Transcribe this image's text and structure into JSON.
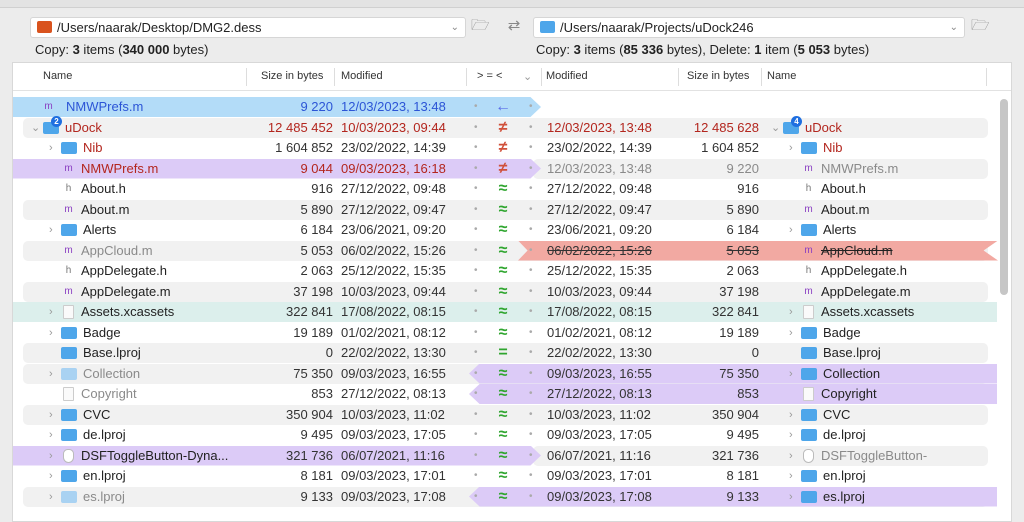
{
  "left_path": "/Users/naarak/Desktop/DMG2.dess",
  "right_path": "/Users/naarak/Projects/uDock246",
  "left_summary": {
    "a": "Copy: ",
    "b": "3",
    "c": " items (",
    "d": "340 000",
    "e": " bytes)"
  },
  "right_summary": {
    "a": "Copy: ",
    "b": "3",
    "c": " items (",
    "d": "85 336",
    "e": " bytes), Delete: ",
    "f": "1",
    "g": " item (",
    "h": "5 053",
    "i": " bytes)"
  },
  "columns": {
    "name": "Name",
    "size": "Size in bytes",
    "modified": "Modified",
    "compare": "> = <",
    "r_modified": "Modified",
    "r_size": "Size in bytes",
    "r_name": "Name"
  },
  "colors": {
    "accent": "#1f6fe0",
    "blue_band": "#b3dcf8",
    "purple_band": "#dccbf7",
    "red_band": "#f2a9a2",
    "teal_band": "#dcefec",
    "diff_red": "#b3261e",
    "same_green": "#2fa52f"
  },
  "rows": [
    {
      "style": "blue-left",
      "sign": "←",
      "l": {
        "name": "NMWPrefs.m",
        "size": "9 220",
        "date": "12/03/2023, 13:48",
        "icon": "m",
        "lvl": 0,
        "tc": "blue"
      },
      "r": null
    },
    {
      "style": "gray",
      "sign": "≠",
      "l": {
        "name": "uDock",
        "size": "12 485 452",
        "date": "10/03/2023, 09:44",
        "icon": "folder",
        "lvl": 0,
        "open": true,
        "badge": "2",
        "tc": "red",
        "nc": "red"
      },
      "r": {
        "name": "uDock",
        "size": "12 485 628",
        "date": "12/03/2023, 13:48",
        "icon": "folder",
        "lvl": 0,
        "open": true,
        "badge": "4",
        "tc": "red",
        "nc": "red"
      }
    },
    {
      "style": "",
      "sign": "≠",
      "l": {
        "name": "Nib",
        "size": "1 604 852",
        "date": "23/02/2022, 14:39",
        "icon": "folder",
        "lvl": 1,
        "chev": true,
        "nc": "red"
      },
      "r": {
        "name": "Nib",
        "size": "1 604 852",
        "date": "23/02/2022, 14:39",
        "icon": "folder",
        "lvl": 1,
        "chev": true,
        "nc": "red"
      }
    },
    {
      "style": "purple-left gray-right",
      "sign": "≠",
      "l": {
        "name": "NMWPrefs.m",
        "size": "9 044",
        "date": "09/03/2023, 16:18",
        "icon": "m",
        "lvl": 1,
        "tc": "red"
      },
      "r": {
        "name": "NMWPrefs.m",
        "size": "9 220",
        "date": "12/03/2023, 13:48",
        "icon": "m",
        "lvl": 1,
        "tc": "gray",
        "nc": "gray"
      }
    },
    {
      "style": "",
      "sign": "≈",
      "l": {
        "name": "About.h",
        "size": "916",
        "date": "27/12/2022, 09:48",
        "icon": "h",
        "lvl": 1
      },
      "r": {
        "name": "About.h",
        "size": "916",
        "date": "27/12/2022, 09:48",
        "icon": "h",
        "lvl": 1
      }
    },
    {
      "style": "gray",
      "sign": "≈",
      "l": {
        "name": "About.m",
        "size": "5 890",
        "date": "27/12/2022, 09:47",
        "icon": "m",
        "lvl": 1
      },
      "r": {
        "name": "About.m",
        "size": "5 890",
        "date": "27/12/2022, 09:47",
        "icon": "m",
        "lvl": 1
      }
    },
    {
      "style": "",
      "sign": "≈",
      "l": {
        "name": "Alerts",
        "size": "6 184",
        "date": "23/06/2021, 09:20",
        "icon": "folder",
        "lvl": 1,
        "chev": true
      },
      "r": {
        "name": "Alerts",
        "size": "6 184",
        "date": "23/06/2021, 09:20",
        "icon": "folder",
        "lvl": 1,
        "chev": true
      }
    },
    {
      "style": "gray red-right",
      "sign": "≈",
      "l": {
        "name": "AppCloud.m",
        "size": "5 053",
        "date": "06/02/2022, 15:26",
        "icon": "m",
        "lvl": 1,
        "nc": "gray"
      },
      "r": {
        "name": "AppCloud.m",
        "size": "5 053",
        "date": "06/02/2022, 15:26",
        "icon": "m",
        "lvl": 1,
        "strike": true
      }
    },
    {
      "style": "",
      "sign": "≈",
      "l": {
        "name": "AppDelegate.h",
        "size": "2 063",
        "date": "25/12/2022, 15:35",
        "icon": "h",
        "lvl": 1
      },
      "r": {
        "name": "AppDelegate.h",
        "size": "2 063",
        "date": "25/12/2022, 15:35",
        "icon": "h",
        "lvl": 1
      }
    },
    {
      "style": "gray",
      "sign": "≈",
      "l": {
        "name": "AppDelegate.m",
        "size": "37 198",
        "date": "10/03/2023, 09:44",
        "icon": "m",
        "lvl": 1
      },
      "r": {
        "name": "AppDelegate.m",
        "size": "37 198",
        "date": "10/03/2023, 09:44",
        "icon": "m",
        "lvl": 1
      }
    },
    {
      "style": "teal",
      "sign": "≈",
      "l": {
        "name": "Assets.xcassets",
        "size": "322 841",
        "date": "17/08/2022, 08:15",
        "icon": "blank",
        "lvl": 1,
        "chev": true
      },
      "r": {
        "name": "Assets.xcassets",
        "size": "322 841",
        "date": "17/08/2022, 08:15",
        "icon": "blank",
        "lvl": 1,
        "chev": true
      }
    },
    {
      "style": "",
      "sign": "≈",
      "l": {
        "name": "Badge",
        "size": "19 189",
        "date": "01/02/2021, 08:12",
        "icon": "folder",
        "lvl": 1,
        "chev": true
      },
      "r": {
        "name": "Badge",
        "size": "19 189",
        "date": "01/02/2021, 08:12",
        "icon": "folder",
        "lvl": 1,
        "chev": true
      }
    },
    {
      "style": "gray",
      "sign": "=",
      "l": {
        "name": "Base.lproj",
        "size": "0",
        "date": "22/02/2022, 13:30",
        "icon": "folder",
        "lvl": 1
      },
      "r": {
        "name": "Base.lproj",
        "size": "0",
        "date": "22/02/2022, 13:30",
        "icon": "folder",
        "lvl": 1
      }
    },
    {
      "style": "gray purple-right",
      "sign": "≈",
      "l": {
        "name": "Collection",
        "size": "75 350",
        "date": "09/03/2023, 16:55",
        "icon": "folder",
        "pale": true,
        "lvl": 1,
        "chev": true,
        "nc": "gray"
      },
      "r": {
        "name": "Collection",
        "size": "75 350",
        "date": "09/03/2023, 16:55",
        "icon": "folder",
        "lvl": 1,
        "chev": true
      }
    },
    {
      "style": "purple-right",
      "sign": "≈",
      "l": {
        "name": "Copyright",
        "size": "853",
        "date": "27/12/2022, 08:13",
        "icon": "blank",
        "lvl": 1,
        "nc": "gray"
      },
      "r": {
        "name": "Copyright",
        "size": "853",
        "date": "27/12/2022, 08:13",
        "icon": "blank",
        "lvl": 1
      }
    },
    {
      "style": "gray",
      "sign": "≈",
      "l": {
        "name": "CVC",
        "size": "350 904",
        "date": "10/03/2023, 11:02",
        "icon": "folder",
        "lvl": 1,
        "chev": true
      },
      "r": {
        "name": "CVC",
        "size": "350 904",
        "date": "10/03/2023, 11:02",
        "icon": "folder",
        "lvl": 1,
        "chev": true
      }
    },
    {
      "style": "",
      "sign": "≈",
      "l": {
        "name": "de.lproj",
        "size": "9 495",
        "date": "09/03/2023, 17:05",
        "icon": "folder",
        "lvl": 1,
        "chev": true
      },
      "r": {
        "name": "de.lproj",
        "size": "9 495",
        "date": "09/03/2023, 17:05",
        "icon": "folder",
        "lvl": 1,
        "chev": true
      }
    },
    {
      "style": "purple-left gray-right",
      "sign": "≈",
      "l": {
        "name": "DSFToggleButton-Dyna...",
        "size": "321 736",
        "date": "06/07/2021, 11:16",
        "icon": "shield",
        "lvl": 1,
        "chev": true
      },
      "r": {
        "name": "DSFToggleButton-",
        "size": "321 736",
        "date": "06/07/2021, 11:16",
        "icon": "shield",
        "lvl": 1,
        "chev": true,
        "nc": "gray"
      }
    },
    {
      "style": "",
      "sign": "≈",
      "l": {
        "name": "en.lproj",
        "size": "8 181",
        "date": "09/03/2023, 17:01",
        "icon": "folder",
        "lvl": 1,
        "chev": true
      },
      "r": {
        "name": "en.lproj",
        "size": "8 181",
        "date": "09/03/2023, 17:01",
        "icon": "folder",
        "lvl": 1,
        "chev": true
      }
    },
    {
      "style": "gray purple-right",
      "sign": "≈",
      "l": {
        "name": "es.lproj",
        "size": "9 133",
        "date": "09/03/2023, 17:08",
        "icon": "folder",
        "pale": true,
        "lvl": 1,
        "chev": true,
        "nc": "gray"
      },
      "r": {
        "name": "es.lproj",
        "size": "9 133",
        "date": "09/03/2023, 17:08",
        "icon": "folder",
        "lvl": 1,
        "chev": true
      }
    }
  ]
}
